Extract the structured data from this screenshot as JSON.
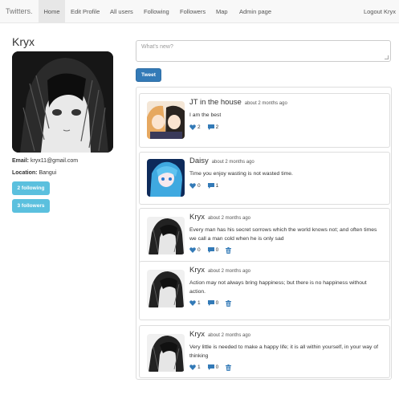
{
  "navbar": {
    "brand": "Twitters.",
    "items": [
      {
        "label": "Home",
        "active": true
      },
      {
        "label": "Edit Profile",
        "active": false
      },
      {
        "label": "All users",
        "active": false
      },
      {
        "label": "Following",
        "active": false
      },
      {
        "label": "Followers",
        "active": false
      },
      {
        "label": "Map",
        "active": false
      },
      {
        "label": "Admin page",
        "active": false
      }
    ],
    "logout": "Logout Kryx"
  },
  "profile": {
    "name": "Kryx",
    "email_label": "Email:",
    "email": "kryx11@gmail.com",
    "location_label": "Location:",
    "location": "Bangui",
    "following_button": "2 following",
    "followers_button": "3 followers"
  },
  "composer": {
    "placeholder": "What's new?",
    "tweet_button": "Tweet"
  },
  "colors": {
    "accent": "#337ab7",
    "info": "#5bc0de",
    "icon": "#337ab7"
  },
  "feed": [
    {
      "author": "JT in the house",
      "time": "about 2 months ago",
      "text": "I am the best",
      "likes": "2",
      "comments": "2",
      "deletable": false,
      "avatar": "couple-avatar"
    },
    {
      "author": "Daisy",
      "time": "about 2 months ago",
      "text": "Time you enjoy wasting is not wasted time.",
      "likes": "0",
      "comments": "1",
      "deletable": false,
      "avatar": "blue-hair-avatar"
    },
    {
      "author": "Kryx",
      "time": "about 2 months ago",
      "text": "Every man has his secret sorrows which the world knows not; and often times we call a man cold when he is only sad",
      "likes": "0",
      "comments": "0",
      "deletable": true,
      "avatar": "sketch-avatar"
    },
    {
      "author": "Kryx",
      "time": "about 2 months ago",
      "text": "Action may not always bring happiness; but there is no happiness without action.",
      "likes": "1",
      "comments": "0",
      "deletable": true,
      "avatar": "sketch-avatar"
    },
    {
      "author": "Kryx",
      "time": "about 2 months ago",
      "text": "Very little is needed to make a happy life; it is all within yourself, in your way of thinking",
      "likes": "1",
      "comments": "0",
      "deletable": true,
      "avatar": "sketch-avatar"
    }
  ]
}
